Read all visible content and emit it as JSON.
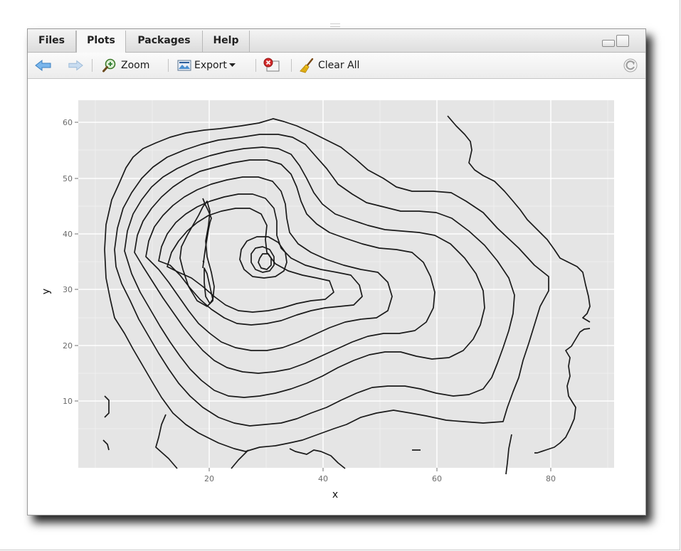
{
  "tabs": [
    {
      "label": "Files",
      "active": false
    },
    {
      "label": "Plots",
      "active": true
    },
    {
      "label": "Packages",
      "active": false
    },
    {
      "label": "Help",
      "active": false
    }
  ],
  "toolbar": {
    "back_icon": "back-arrow-icon",
    "forward_icon": "forward-arrow-icon",
    "zoom_label": "Zoom",
    "export_label": "Export",
    "remove_icon": "remove-plot-icon",
    "clear_label": "Clear All",
    "refresh_icon": "refresh-icon"
  },
  "colors": {
    "panel_bg": "#e5e5e5",
    "grid": "#ffffff",
    "contour": "#1a1a1a",
    "back_arrow": "#5aa0e0"
  },
  "chart_data": {
    "type": "contour",
    "xlabel": "x",
    "ylabel": "y",
    "x_ticks": [
      20,
      40,
      60,
      80
    ],
    "y_ticks": [
      10,
      20,
      30,
      40,
      50,
      60
    ],
    "xlim": [
      -1,
      91
    ],
    "ylim": [
      -1,
      65
    ],
    "grid": true,
    "legend": "none"
  }
}
